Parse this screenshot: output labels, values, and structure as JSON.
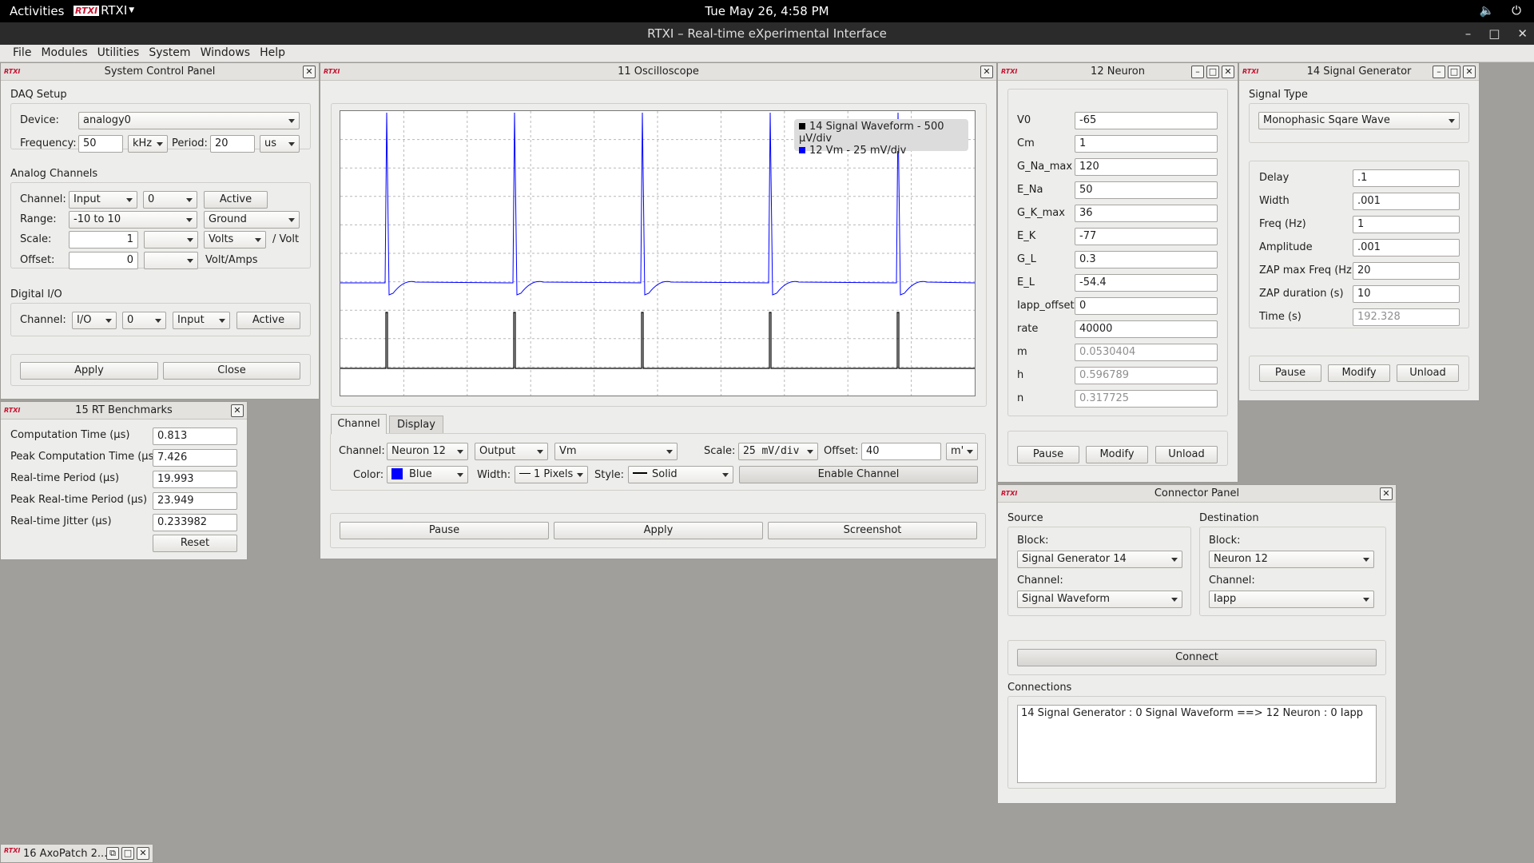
{
  "topbar": {
    "activities": "Activities",
    "app_name": "RTXI",
    "clock": "Tue May 26,  4:58 PM",
    "logo": "RTXI"
  },
  "window_title": "RTXI – Real-time eXperimental Interface",
  "menu": [
    "File",
    "Modules",
    "Utilities",
    "System",
    "Windows",
    "Help"
  ],
  "system_control": {
    "title": "System Control Panel",
    "daq_setup": "DAQ Setup",
    "device_label": "Device:",
    "device": "analogy0",
    "frequency_label": "Frequency:",
    "frequency": "50",
    "frequency_unit": "kHz",
    "period_label": "Period:",
    "period": "20",
    "period_unit": "us",
    "analog_channels": "Analog Channels",
    "channel_label": "Channel:",
    "channel_type": "Input",
    "channel_num": "0",
    "active": "Active",
    "range_label": "Range:",
    "range": "-10 to 10",
    "reference": "Ground",
    "scale_label": "Scale:",
    "scale": "1",
    "scale_unit": "Volts",
    "scale_suffix": "/ Volt",
    "offset_label": "Offset:",
    "offset": "0",
    "offset_suffix": "Volt/Amps",
    "digital_io": "Digital I/O",
    "dio_channel_label": "Channel:",
    "dio_type": "I/O",
    "dio_num": "0",
    "dio_dir": "Input",
    "dio_active": "Active",
    "apply": "Apply",
    "close": "Close"
  },
  "benchmarks": {
    "title": "15 RT Benchmarks",
    "rows": [
      {
        "label": "Computation Time (µs)",
        "value": "0.813"
      },
      {
        "label": "Peak Computation Time (µs)",
        "value": "7.426"
      },
      {
        "label": "Real-time Period (µs)",
        "value": "19.993"
      },
      {
        "label": "Peak Real-time Period (µs)",
        "value": "23.949"
      },
      {
        "label": "Real-time Jitter (µs)",
        "value": "0.233982"
      }
    ],
    "reset": "Reset"
  },
  "oscilloscope": {
    "title": "11 Oscilloscope",
    "legend": [
      {
        "label": "14 Signal Waveform - 500 µV/div",
        "color": "#000000"
      },
      {
        "label": "12 Vm - 25 mV/div",
        "color": "#0000ff"
      }
    ],
    "tabs": [
      "Channel",
      "Display"
    ],
    "channel_label": "Channel:",
    "channel_block": "Neuron 12",
    "channel_dir": "Output",
    "channel_var": "Vm",
    "scale_label": "Scale:",
    "scale": "25 mV/div",
    "offset_label": "Offset:",
    "offset": "40",
    "offset_unit": "m'",
    "color_label": "Color:",
    "color": "Blue",
    "color_hex": "#0000ff",
    "width_label": "Width:",
    "width": "1 Pixels",
    "style_label": "Style:",
    "style": "Solid",
    "enable_channel": "Enable Channel",
    "pause": "Pause",
    "apply": "Apply",
    "screenshot": "Screenshot"
  },
  "neuron": {
    "title": "12 Neuron",
    "params": [
      {
        "label": "V0",
        "value": "-65",
        "readonly": false
      },
      {
        "label": "Cm",
        "value": "1",
        "readonly": false
      },
      {
        "label": "G_Na_max",
        "value": "120",
        "readonly": false
      },
      {
        "label": "E_Na",
        "value": "50",
        "readonly": false
      },
      {
        "label": "G_K_max",
        "value": "36",
        "readonly": false
      },
      {
        "label": "E_K",
        "value": "-77",
        "readonly": false
      },
      {
        "label": "G_L",
        "value": "0.3",
        "readonly": false
      },
      {
        "label": "E_L",
        "value": "-54.4",
        "readonly": false
      },
      {
        "label": "Iapp_offset",
        "value": "0",
        "readonly": false
      },
      {
        "label": "rate",
        "value": "40000",
        "readonly": false
      },
      {
        "label": "m",
        "value": "0.0530404",
        "readonly": true
      },
      {
        "label": "h",
        "value": "0.596789",
        "readonly": true
      },
      {
        "label": "n",
        "value": "0.317725",
        "readonly": true
      }
    ],
    "pause": "Pause",
    "modify": "Modify",
    "unload": "Unload"
  },
  "signal_generator": {
    "title": "14 Signal Generator",
    "signal_type_label": "Signal Type",
    "signal_type": "Monophasic Sqare Wave",
    "params": [
      {
        "label": "Delay",
        "value": ".1",
        "readonly": false
      },
      {
        "label": "Width",
        "value": ".001",
        "readonly": false
      },
      {
        "label": "Freq (Hz)",
        "value": "1",
        "readonly": false
      },
      {
        "label": "Amplitude",
        "value": ".001",
        "readonly": false
      },
      {
        "label": "ZAP max Freq (Hz)",
        "value": "20",
        "readonly": false
      },
      {
        "label": "ZAP duration (s)",
        "value": "10",
        "readonly": false
      },
      {
        "label": "Time (s)",
        "value": "192.328",
        "readonly": true
      }
    ],
    "pause": "Pause",
    "modify": "Modify",
    "unload": "Unload"
  },
  "connector": {
    "title": "Connector Panel",
    "source": "Source",
    "destination": "Destination",
    "block_label": "Block:",
    "channel_label": "Channel:",
    "source_block": "Signal Generator 14",
    "source_channel": "Signal Waveform",
    "dest_block": "Neuron 12",
    "dest_channel": "Iapp",
    "connect": "Connect",
    "connections_label": "Connections",
    "connections": [
      "14 Signal Generator : 0 Signal Waveform ==> 12 Neuron : 0 Iapp"
    ]
  },
  "axopatch": {
    "title": "16 AxoPatch 2..."
  }
}
